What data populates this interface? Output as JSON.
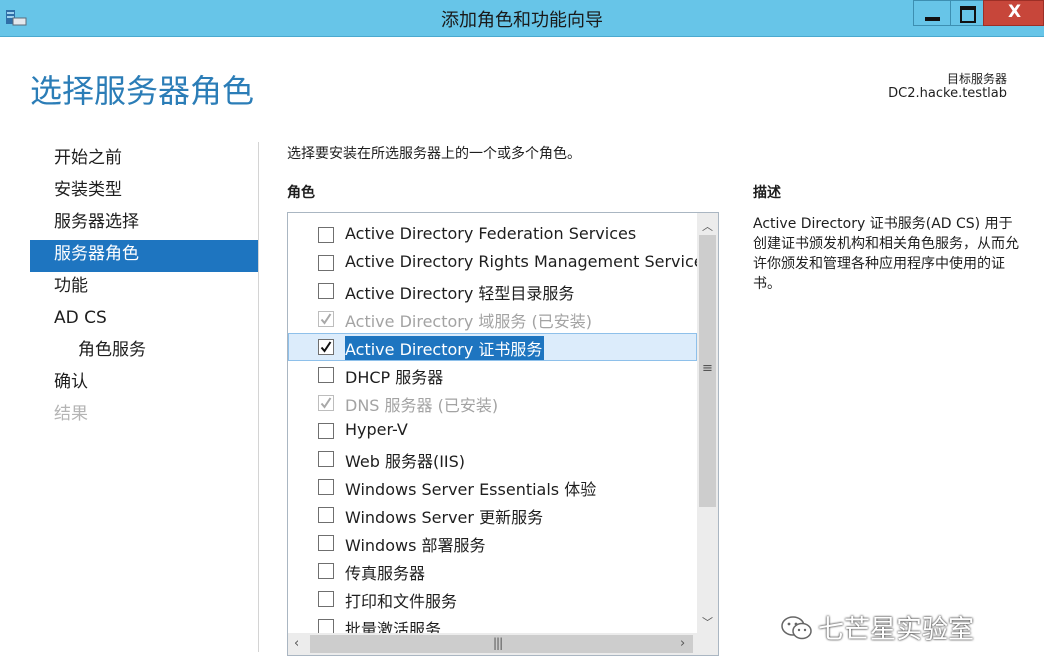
{
  "window": {
    "title": "添加角色和功能向导",
    "close_glyph": "X"
  },
  "header": {
    "page_title": "选择服务器角色",
    "target_label": "目标服务器",
    "target_value": "DC2.hacke.testlab"
  },
  "nav": {
    "items": [
      {
        "label": "开始之前",
        "state": "normal"
      },
      {
        "label": "安装类型",
        "state": "normal"
      },
      {
        "label": "服务器选择",
        "state": "normal"
      },
      {
        "label": "服务器角色",
        "state": "active"
      },
      {
        "label": "功能",
        "state": "normal"
      },
      {
        "label": "AD CS",
        "state": "normal"
      },
      {
        "label": "角色服务",
        "state": "sub"
      },
      {
        "label": "确认",
        "state": "normal"
      },
      {
        "label": "结果",
        "state": "disabled"
      }
    ]
  },
  "main": {
    "instruction": "选择要安装在所选服务器上的一个或多个角色。",
    "roles_header": "角色",
    "roles": [
      {
        "label": "Active Directory Federation Services",
        "checked": false,
        "installed": false,
        "selected": false
      },
      {
        "label": "Active Directory Rights Management Services",
        "checked": false,
        "installed": false,
        "selected": false
      },
      {
        "label": "Active Directory 轻型目录服务",
        "checked": false,
        "installed": false,
        "selected": false
      },
      {
        "label": "Active Directory 域服务 (已安装)",
        "checked": true,
        "installed": true,
        "selected": false
      },
      {
        "label": "Active Directory 证书服务",
        "checked": true,
        "installed": false,
        "selected": true
      },
      {
        "label": "DHCP 服务器",
        "checked": false,
        "installed": false,
        "selected": false
      },
      {
        "label": "DNS 服务器 (已安装)",
        "checked": true,
        "installed": true,
        "selected": false
      },
      {
        "label": "Hyper-V",
        "checked": false,
        "installed": false,
        "selected": false
      },
      {
        "label": "Web 服务器(IIS)",
        "checked": false,
        "installed": false,
        "selected": false
      },
      {
        "label": "Windows Server Essentials 体验",
        "checked": false,
        "installed": false,
        "selected": false
      },
      {
        "label": "Windows Server 更新服务",
        "checked": false,
        "installed": false,
        "selected": false
      },
      {
        "label": "Windows 部署服务",
        "checked": false,
        "installed": false,
        "selected": false
      },
      {
        "label": "传真服务器",
        "checked": false,
        "installed": false,
        "selected": false
      },
      {
        "label": "打印和文件服务",
        "checked": false,
        "installed": false,
        "selected": false
      },
      {
        "label": "批量激活服务",
        "checked": false,
        "installed": false,
        "selected": false
      }
    ]
  },
  "description": {
    "header": "描述",
    "text": "Active Directory 证书服务(AD CS) 用于创建证书颁发机构和相关角色服务，从而允许你颁发和管理各种应用程序中使用的证书。"
  },
  "watermark": {
    "text": "七芒星实验室"
  },
  "colors": {
    "titlebar": "#67c5e8",
    "accent": "#1e75c0",
    "page_title": "#2b7db7",
    "close": "#c7463a"
  }
}
